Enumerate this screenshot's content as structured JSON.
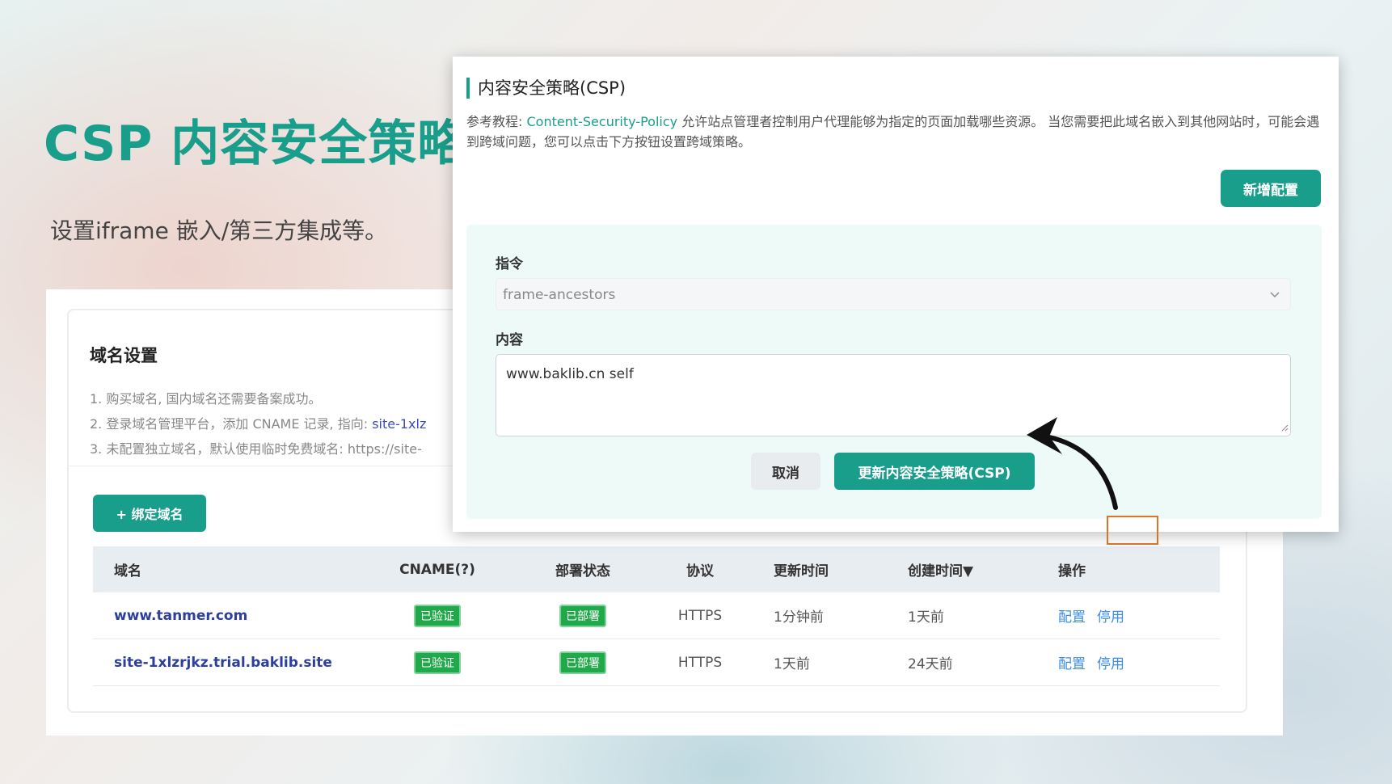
{
  "hero": {
    "title": "CSP 内容安全策略",
    "subtitle": "设置iframe 嵌入/第三方集成等。"
  },
  "domain_settings": {
    "title": "域名设置",
    "steps": [
      "1. 购买域名, 国内域名还需要备案成功。",
      "2. 登录域名管理平台，添加 CNAME 记录, 指向: ",
      "3. 未配置独立域名，默认使用临时免费域名: https://site-"
    ],
    "step2_link": "site-1xlz",
    "bind_button": "+ 绑定域名",
    "table": {
      "headers": [
        "域名",
        "CNAME(?)",
        "部署状态",
        "协议",
        "更新时间",
        "创建时间▼",
        "操作"
      ],
      "rows": [
        {
          "domain": "www.tanmer.com",
          "cname": "已验证",
          "status": "已部署",
          "protocol": "HTTPS",
          "updated": "1分钟前",
          "created": "1天前",
          "action_config": "配置",
          "action_disable": "停用"
        },
        {
          "domain": "site-1xlzrjkz.trial.baklib.site",
          "cname": "已验证",
          "status": "已部署",
          "protocol": "HTTPS",
          "updated": "1天前",
          "created": "24天前",
          "action_config": "配置",
          "action_disable": "停用"
        }
      ]
    }
  },
  "csp_modal": {
    "title": "内容安全策略(CSP)",
    "desc_prefix": "参考教程: ",
    "desc_link": "Content-Security-Policy",
    "desc_suffix": " 允许站点管理者控制用户代理能够为指定的页面加载哪些资源。 当您需要把此域名嵌入到其他网站时，可能会遇到跨域问题，您可以点击下方按钮设置跨域策略。",
    "add_button": "新增配置",
    "directive_label": "指令",
    "directive_value": "frame-ancestors",
    "content_label": "内容",
    "content_value": "www.baklib.cn self",
    "cancel_button": "取消",
    "update_button": "更新内容安全策略(CSP)"
  },
  "colors": {
    "accent": "#1a9e8c",
    "badge_green": "#20a84a",
    "link_blue": "#3d8ee0",
    "highlight_orange": "#d9742b"
  }
}
